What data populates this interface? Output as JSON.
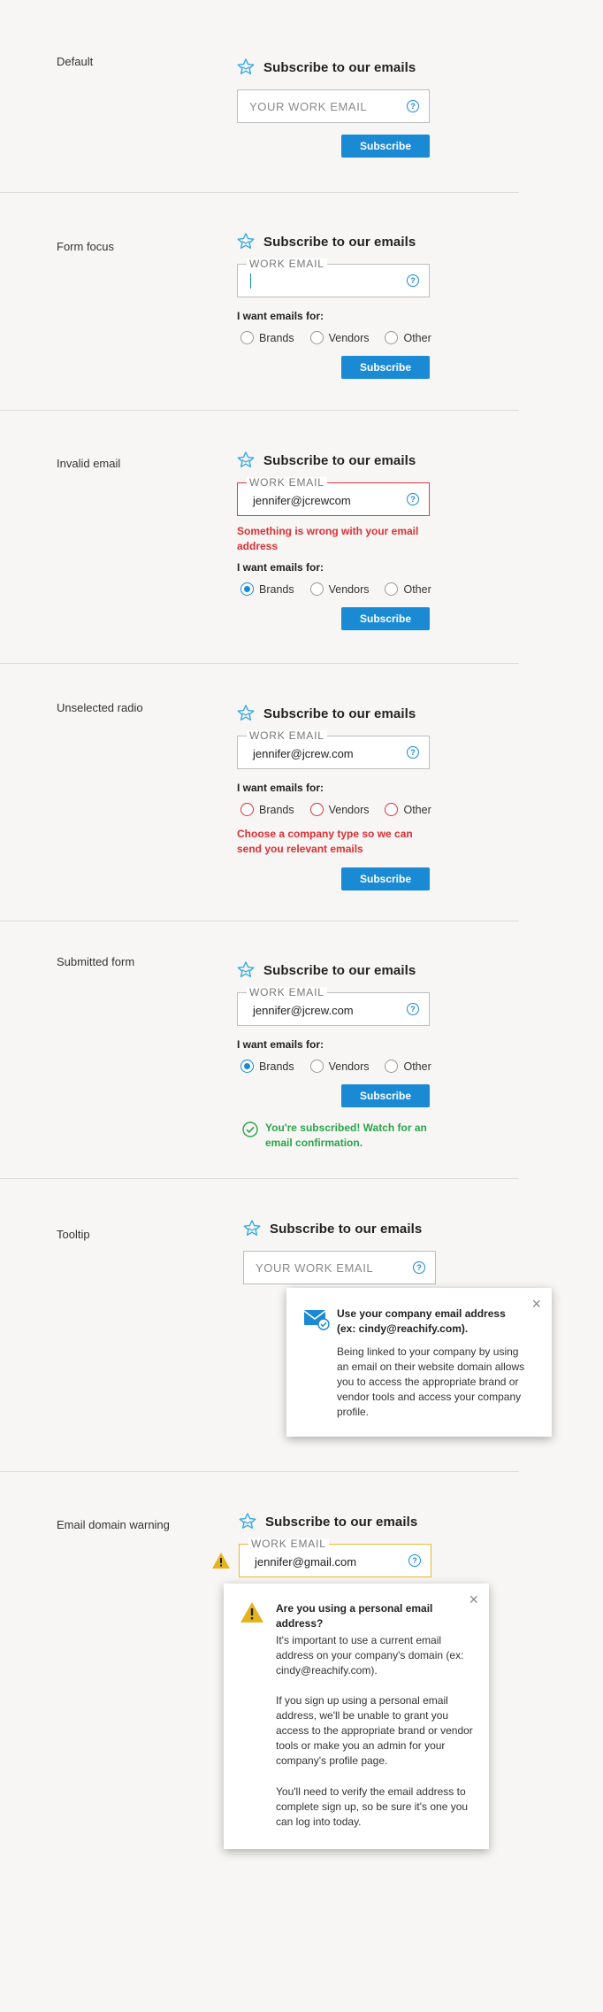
{
  "form_title": "Subscribe to our emails",
  "email_placeholder": "YOUR WORK EMAIL",
  "email_label": "WORK EMAIL",
  "help_glyph": "?",
  "want_label": "I want emails for:",
  "radio_options": [
    "Brands",
    "Vendors",
    "Other"
  ],
  "subscribe_label": "Subscribe",
  "close_glyph": "×",
  "colors": {
    "accent": "#1a8ad4",
    "error": "#d93035",
    "success": "#2aa44a",
    "warning": "#e8b92a"
  },
  "icons": {
    "logo": "star-envelope-icon",
    "help": "question-circle-icon",
    "success": "check-circle-icon",
    "warning": "warning-triangle-icon",
    "mail": "mail-check-icon",
    "close": "close-icon"
  },
  "sections": {
    "default": {
      "label": "Default"
    },
    "focus": {
      "label": "Form focus"
    },
    "invalid": {
      "label": "Invalid email",
      "value": "jennifer@jcrewcom",
      "error": "Something is wrong with your email address",
      "selected": "Brands"
    },
    "unselected": {
      "label": "Unselected radio",
      "value": "jennifer@jcrew.com",
      "error": "Choose a company type so we can send you relevant emails"
    },
    "submitted": {
      "label": "Submitted form",
      "value": "jennifer@jcrew.com",
      "selected": "Brands",
      "success": "You're subscribed! Watch for an email confirmation."
    },
    "tooltip": {
      "label": "Tooltip",
      "title": "Use your company email address (ex: cindy@reachify.com).",
      "body": "Being linked to your company by using an email on their website domain allows you to access the appropriate brand or vendor tools and access your company profile."
    },
    "warning": {
      "label": "Email domain warning",
      "value": "jennifer@gmail.com",
      "title": "Are you using a personal email address?",
      "p1": "It's important to use a current email address on your company's domain (ex: cindy@reachify.com).",
      "p2": "If you sign up using a personal email address, we'll be unable to grant you access to the appropriate brand or vendor tools or make you an admin for your company's profile page.",
      "p3": "You'll need to verify the email address to complete sign up, so be sure it's one you can log into today."
    }
  }
}
